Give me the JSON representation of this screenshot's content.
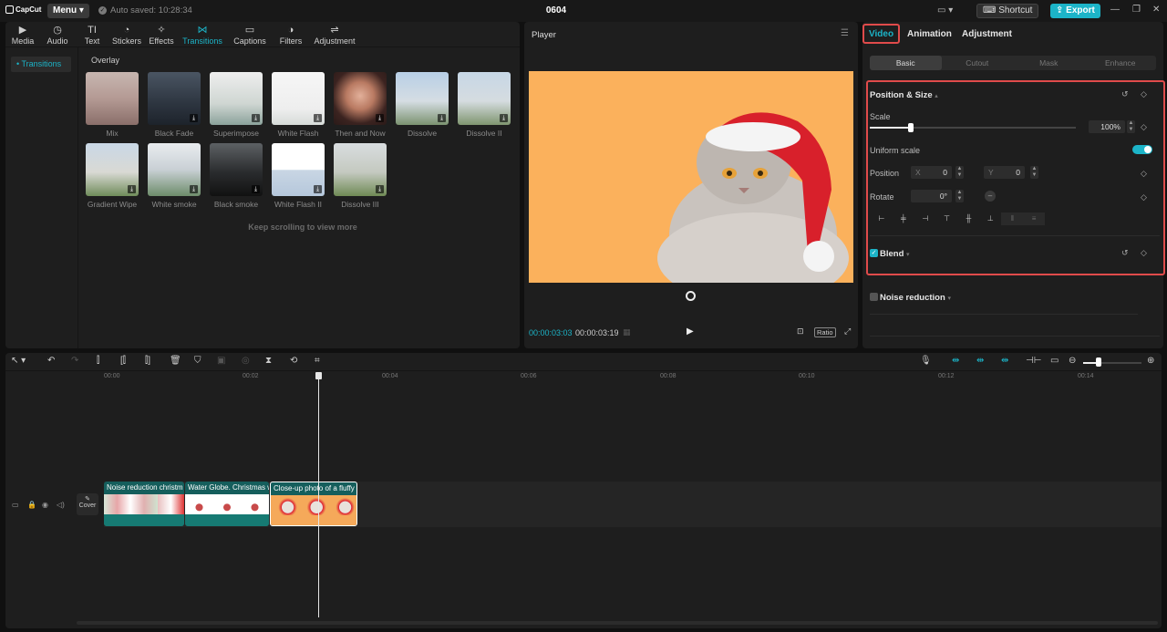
{
  "app": {
    "logo_text": "CapCut",
    "menu_label": "Menu",
    "autosave": "Auto saved: 10:28:34",
    "project_title": "0604",
    "shortcut_label": "Shortcut",
    "export_label": "Export"
  },
  "toolbar": {
    "tabs": [
      {
        "label": "Media",
        "icon": "media-icon"
      },
      {
        "label": "Audio",
        "icon": "audio-icon"
      },
      {
        "label": "Text",
        "icon": "text-icon"
      },
      {
        "label": "Stickers",
        "icon": "stickers-icon"
      },
      {
        "label": "Effects",
        "icon": "effects-icon"
      },
      {
        "label": "Transitions",
        "icon": "transitions-icon",
        "active": true
      },
      {
        "label": "Captions",
        "icon": "captions-icon"
      },
      {
        "label": "Filters",
        "icon": "filters-icon"
      },
      {
        "label": "Adjustment",
        "icon": "adjustment-icon"
      }
    ]
  },
  "sidebar": {
    "active_item": "• Transitions"
  },
  "transitions": {
    "section": "Overlay",
    "items": [
      {
        "label": "Mix"
      },
      {
        "label": "Black Fade"
      },
      {
        "label": "Superimpose"
      },
      {
        "label": "White Flash"
      },
      {
        "label": "Then and Now"
      },
      {
        "label": "Dissolve"
      },
      {
        "label": "Dissolve II"
      },
      {
        "label": "Gradient Wipe"
      },
      {
        "label": "White smoke"
      },
      {
        "label": "Black smoke"
      },
      {
        "label": "White Flash II"
      },
      {
        "label": "Dissolve III"
      }
    ],
    "footer": "Keep scrolling to view more"
  },
  "player": {
    "title": "Player",
    "current_time": "00:00:03:03",
    "total_time": "00:00:03:19",
    "ratio_label": "Ratio"
  },
  "inspector": {
    "tabs": [
      "Video",
      "Animation",
      "Adjustment"
    ],
    "subtabs": [
      "Basic",
      "Cutout",
      "Mask",
      "Enhance"
    ],
    "position_size_title": "Position & Size",
    "scale_label": "Scale",
    "scale_value": "100%",
    "scale_fraction": 0.2,
    "uniform_scale_label": "Uniform scale",
    "uniform_scale_on": true,
    "position_label": "Position",
    "pos_x_prefix": "X",
    "pos_x": "0",
    "pos_y_prefix": "Y",
    "pos_y": "0",
    "rotate_label": "Rotate",
    "rotate_value": "0°",
    "blend_title": "Blend",
    "noise_title": "Noise reduction"
  },
  "timeline": {
    "ruler": [
      "00:00",
      "00:02",
      "00:04",
      "00:06",
      "00:08",
      "00:10",
      "00:12",
      "00:14"
    ],
    "cover_label": "Cover",
    "clips": [
      {
        "label": "Noise reduction   christm"
      },
      {
        "label": "Water Globe. Christmas w"
      },
      {
        "label": "Close-up photo of a fluffy"
      }
    ]
  },
  "colors": {
    "accent": "#1cb4c8",
    "highlight": "#e04b4b",
    "video_bg": "#fbb15c"
  }
}
